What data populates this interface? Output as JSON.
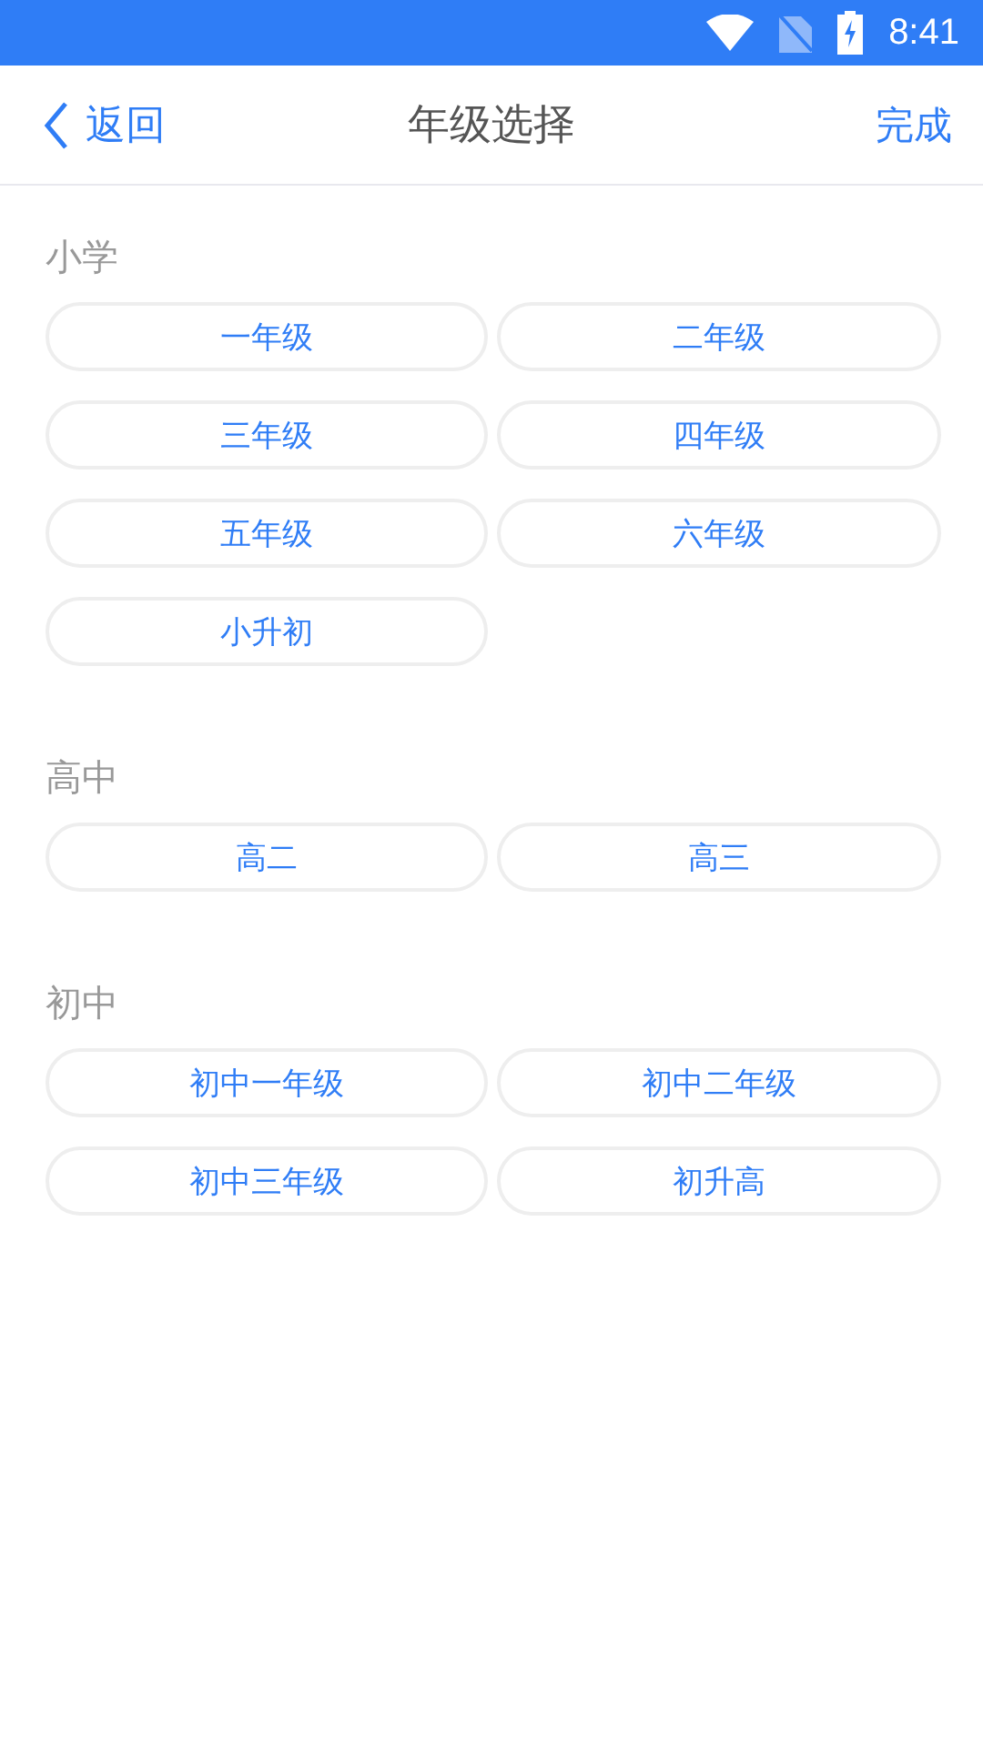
{
  "status_bar": {
    "time": "8:41"
  },
  "header": {
    "back": "返回",
    "title": "年级选择",
    "done": "完成"
  },
  "sections": [
    {
      "title": "小学",
      "grades": [
        "一年级",
        "二年级",
        "三年级",
        "四年级",
        "五年级",
        "六年级",
        "小升初"
      ]
    },
    {
      "title": "高中",
      "grades": [
        "高二",
        "高三"
      ]
    },
    {
      "title": "初中",
      "grades": [
        "初中一年级",
        "初中二年级",
        "初中三年级",
        "初升高"
      ]
    }
  ]
}
